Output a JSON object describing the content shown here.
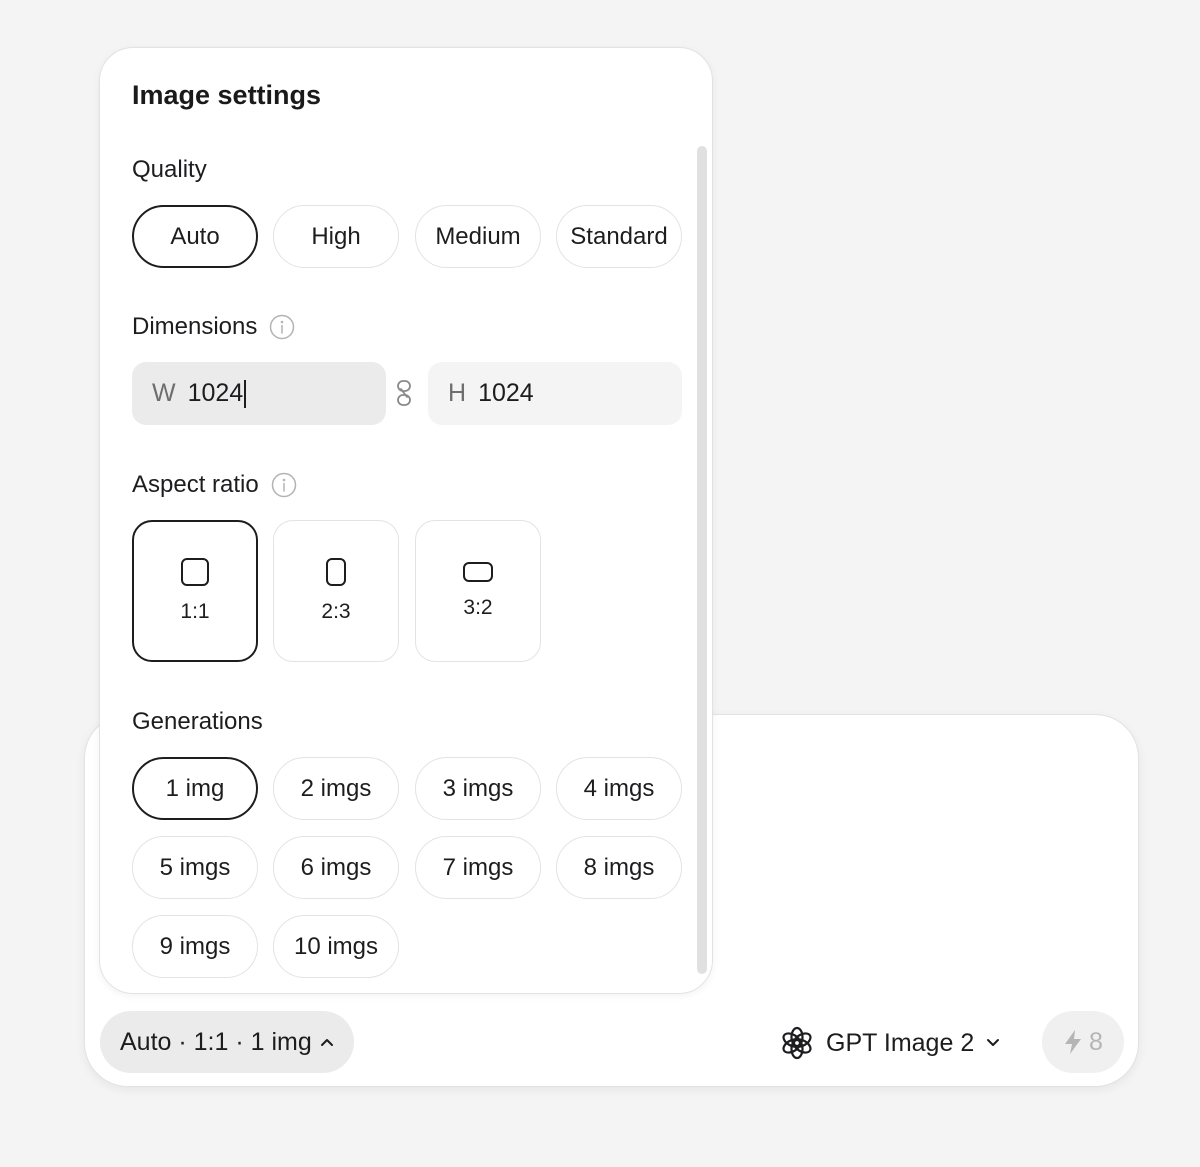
{
  "composer": {
    "settings_summary": "Auto · 1:1 · 1 img",
    "model_name": "GPT Image 2",
    "credits": "8"
  },
  "panel": {
    "title": "Image settings",
    "quality": {
      "label": "Quality",
      "options": [
        "Auto",
        "High",
        "Medium",
        "Standard"
      ],
      "selected": "Auto"
    },
    "dimensions": {
      "label": "Dimensions",
      "width_prefix": "W",
      "width_value": "1024",
      "height_prefix": "H",
      "height_value": "1024"
    },
    "aspect_ratio": {
      "label": "Aspect ratio",
      "options": [
        "1:1",
        "2:3",
        "3:2"
      ],
      "selected": "1:1"
    },
    "generations": {
      "label": "Generations",
      "options": [
        "1 img",
        "2 imgs",
        "3 imgs",
        "4 imgs",
        "5 imgs",
        "6 imgs",
        "7 imgs",
        "8 imgs",
        "9 imgs",
        "10 imgs"
      ],
      "selected": "1 img"
    }
  },
  "icons": {
    "info": "info-icon",
    "link": "link-icon",
    "openai": "openai-logo-icon",
    "chevron_up": "chevron-up-icon",
    "chevron_down": "chevron-down-icon",
    "bolt": "bolt-icon"
  },
  "colors": {
    "page_bg": "#f4f4f4",
    "surface": "#ffffff",
    "text": "#1d1d1f",
    "muted": "#6e6e6e",
    "selected_border": "#1d1d1f",
    "pill_bg": "#ebebeb"
  }
}
